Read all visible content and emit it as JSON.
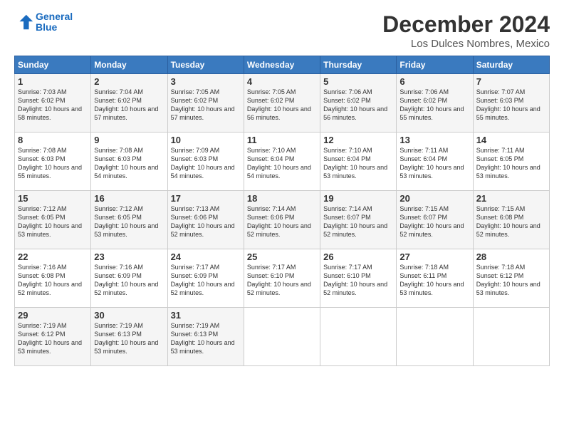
{
  "app": {
    "logo_line1": "General",
    "logo_line2": "Blue"
  },
  "header": {
    "title": "December 2024",
    "subtitle": "Los Dulces Nombres, Mexico"
  },
  "days_of_week": [
    "Sunday",
    "Monday",
    "Tuesday",
    "Wednesday",
    "Thursday",
    "Friday",
    "Saturday"
  ],
  "weeks": [
    [
      {
        "num": "1",
        "sunrise": "7:03 AM",
        "sunset": "6:02 PM",
        "daylight": "10 hours and 58 minutes."
      },
      {
        "num": "2",
        "sunrise": "7:04 AM",
        "sunset": "6:02 PM",
        "daylight": "10 hours and 57 minutes."
      },
      {
        "num": "3",
        "sunrise": "7:05 AM",
        "sunset": "6:02 PM",
        "daylight": "10 hours and 57 minutes."
      },
      {
        "num": "4",
        "sunrise": "7:05 AM",
        "sunset": "6:02 PM",
        "daylight": "10 hours and 56 minutes."
      },
      {
        "num": "5",
        "sunrise": "7:06 AM",
        "sunset": "6:02 PM",
        "daylight": "10 hours and 56 minutes."
      },
      {
        "num": "6",
        "sunrise": "7:06 AM",
        "sunset": "6:02 PM",
        "daylight": "10 hours and 55 minutes."
      },
      {
        "num": "7",
        "sunrise": "7:07 AM",
        "sunset": "6:03 PM",
        "daylight": "10 hours and 55 minutes."
      }
    ],
    [
      {
        "num": "8",
        "sunrise": "7:08 AM",
        "sunset": "6:03 PM",
        "daylight": "10 hours and 55 minutes."
      },
      {
        "num": "9",
        "sunrise": "7:08 AM",
        "sunset": "6:03 PM",
        "daylight": "10 hours and 54 minutes."
      },
      {
        "num": "10",
        "sunrise": "7:09 AM",
        "sunset": "6:03 PM",
        "daylight": "10 hours and 54 minutes."
      },
      {
        "num": "11",
        "sunrise": "7:10 AM",
        "sunset": "6:04 PM",
        "daylight": "10 hours and 54 minutes."
      },
      {
        "num": "12",
        "sunrise": "7:10 AM",
        "sunset": "6:04 PM",
        "daylight": "10 hours and 53 minutes."
      },
      {
        "num": "13",
        "sunrise": "7:11 AM",
        "sunset": "6:04 PM",
        "daylight": "10 hours and 53 minutes."
      },
      {
        "num": "14",
        "sunrise": "7:11 AM",
        "sunset": "6:05 PM",
        "daylight": "10 hours and 53 minutes."
      }
    ],
    [
      {
        "num": "15",
        "sunrise": "7:12 AM",
        "sunset": "6:05 PM",
        "daylight": "10 hours and 53 minutes."
      },
      {
        "num": "16",
        "sunrise": "7:12 AM",
        "sunset": "6:05 PM",
        "daylight": "10 hours and 53 minutes."
      },
      {
        "num": "17",
        "sunrise": "7:13 AM",
        "sunset": "6:06 PM",
        "daylight": "10 hours and 52 minutes."
      },
      {
        "num": "18",
        "sunrise": "7:14 AM",
        "sunset": "6:06 PM",
        "daylight": "10 hours and 52 minutes."
      },
      {
        "num": "19",
        "sunrise": "7:14 AM",
        "sunset": "6:07 PM",
        "daylight": "10 hours and 52 minutes."
      },
      {
        "num": "20",
        "sunrise": "7:15 AM",
        "sunset": "6:07 PM",
        "daylight": "10 hours and 52 minutes."
      },
      {
        "num": "21",
        "sunrise": "7:15 AM",
        "sunset": "6:08 PM",
        "daylight": "10 hours and 52 minutes."
      }
    ],
    [
      {
        "num": "22",
        "sunrise": "7:16 AM",
        "sunset": "6:08 PM",
        "daylight": "10 hours and 52 minutes."
      },
      {
        "num": "23",
        "sunrise": "7:16 AM",
        "sunset": "6:09 PM",
        "daylight": "10 hours and 52 minutes."
      },
      {
        "num": "24",
        "sunrise": "7:17 AM",
        "sunset": "6:09 PM",
        "daylight": "10 hours and 52 minutes."
      },
      {
        "num": "25",
        "sunrise": "7:17 AM",
        "sunset": "6:10 PM",
        "daylight": "10 hours and 52 minutes."
      },
      {
        "num": "26",
        "sunrise": "7:17 AM",
        "sunset": "6:10 PM",
        "daylight": "10 hours and 52 minutes."
      },
      {
        "num": "27",
        "sunrise": "7:18 AM",
        "sunset": "6:11 PM",
        "daylight": "10 hours and 53 minutes."
      },
      {
        "num": "28",
        "sunrise": "7:18 AM",
        "sunset": "6:12 PM",
        "daylight": "10 hours and 53 minutes."
      }
    ],
    [
      {
        "num": "29",
        "sunrise": "7:19 AM",
        "sunset": "6:12 PM",
        "daylight": "10 hours and 53 minutes."
      },
      {
        "num": "30",
        "sunrise": "7:19 AM",
        "sunset": "6:13 PM",
        "daylight": "10 hours and 53 minutes."
      },
      {
        "num": "31",
        "sunrise": "7:19 AM",
        "sunset": "6:13 PM",
        "daylight": "10 hours and 53 minutes."
      },
      null,
      null,
      null,
      null
    ]
  ]
}
